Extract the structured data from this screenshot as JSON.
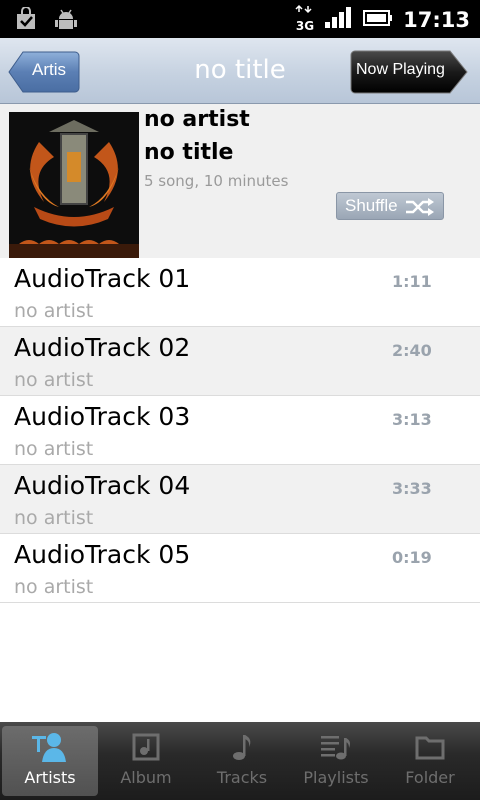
{
  "status_bar": {
    "left_icons": [
      "shopping-bag-icon",
      "android-debug-icon"
    ],
    "network": "3G",
    "time": "17:13"
  },
  "header": {
    "back_label": "Artis",
    "title": "no title",
    "now_playing_label": "Now Playing"
  },
  "album": {
    "artist": "no artist",
    "title": "no title",
    "meta": "5 song, 10 minutes",
    "shuffle_label": "Shuffle"
  },
  "tracks": [
    {
      "title": "AudioTrack 01",
      "artist": "no artist",
      "duration": "1:11"
    },
    {
      "title": "AudioTrack 02",
      "artist": "no artist",
      "duration": "2:40"
    },
    {
      "title": "AudioTrack 03",
      "artist": "no artist",
      "duration": "3:13"
    },
    {
      "title": "AudioTrack 04",
      "artist": "no artist",
      "duration": "3:33"
    },
    {
      "title": "AudioTrack 05",
      "artist": "no artist",
      "duration": "0:19"
    }
  ],
  "tabs": [
    {
      "label": "Artists",
      "icon": "artist-icon",
      "active": true
    },
    {
      "label": "Album",
      "icon": "album-icon",
      "active": false
    },
    {
      "label": "Tracks",
      "icon": "music-note-icon",
      "active": false
    },
    {
      "label": "Playlists",
      "icon": "playlist-icon",
      "active": false
    },
    {
      "label": "Folder",
      "icon": "folder-icon",
      "active": false
    }
  ],
  "colors": {
    "title_bar": "#c6d2e1",
    "back_button": "#5b7fb4",
    "now_playing_button": "#1a1a1a",
    "shuffle_button": "#a9b4c2",
    "duration_text": "#9aa3ad"
  }
}
